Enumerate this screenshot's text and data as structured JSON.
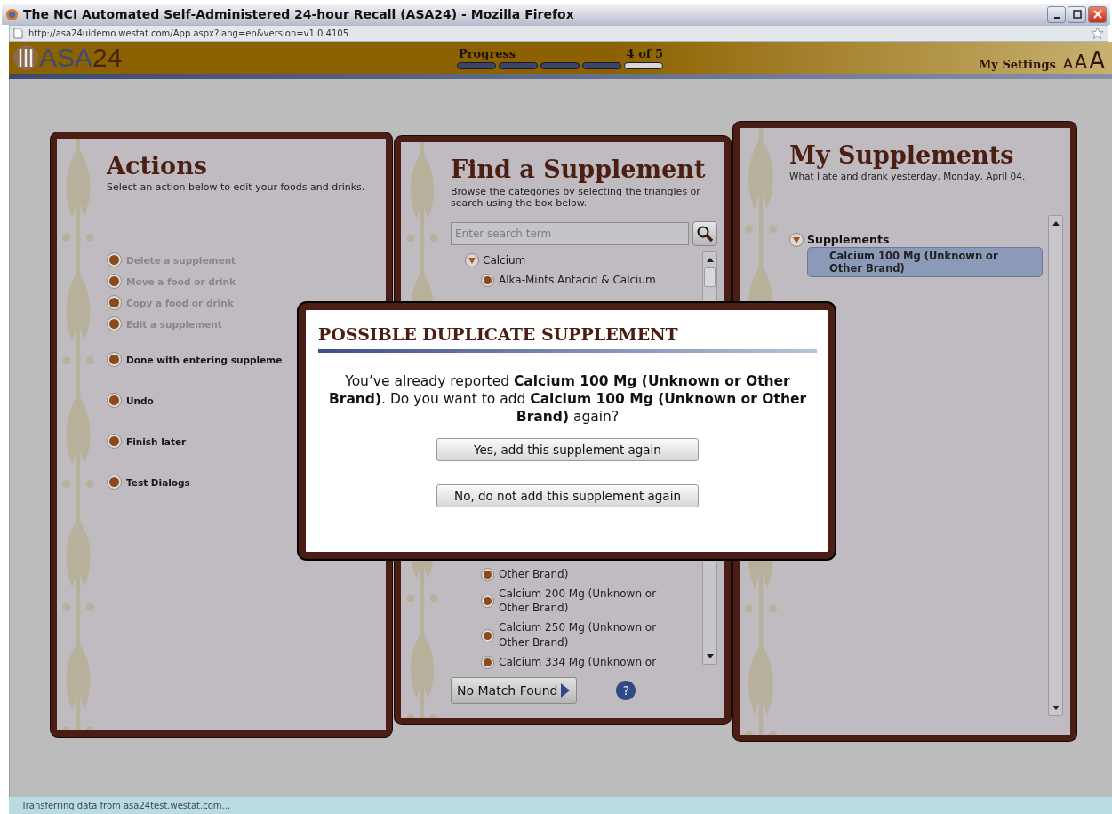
{
  "window": {
    "title": "The NCI Automated Self-Administered 24-hour Recall (ASA24) - Mozilla Firefox"
  },
  "address_bar": {
    "url": "http://asa24uidemo.westat.com/App.aspx?lang=en&version=v1.0.4105"
  },
  "header": {
    "logo_letters": "ASA",
    "logo_digits": "24",
    "progress": {
      "label": "Progress",
      "reading": "4 of 5",
      "steps": [
        {
          "done": true
        },
        {
          "done": true
        },
        {
          "done": true
        },
        {
          "done": true
        },
        {
          "done": false
        }
      ]
    },
    "settings": "My Settings",
    "text_sizes": [
      "A",
      "A",
      "A"
    ]
  },
  "actions_panel": {
    "title": "Actions",
    "subtitle": "Select an action below to edit your foods and drinks.",
    "items": [
      {
        "label": "Delete a supplement",
        "disabled": true
      },
      {
        "label": "Move a food or drink",
        "disabled": true
      },
      {
        "label": "Copy a food or drink",
        "disabled": true
      },
      {
        "label": "Edit a supplement",
        "disabled": true
      },
      {
        "label": "Done with entering suppleme",
        "disabled": false
      },
      {
        "label": "Undo",
        "disabled": false
      },
      {
        "label": "Finish later",
        "disabled": false
      },
      {
        "label": "Test Dialogs",
        "disabled": false
      }
    ]
  },
  "find_panel": {
    "title": "Find a Supplement",
    "description": "Browse the categories by selecting the triangles or search using the box below.",
    "search": {
      "placeholder": "Enter search term"
    },
    "tree": [
      {
        "label": "Calcium",
        "expanded": true,
        "children": [
          {
            "label": "Alka-Mints Antacid & Calcium",
            "kind": "top",
            "selected": false
          },
          {
            "label": "Other Brand)",
            "kind": "cut",
            "selected": false
          },
          {
            "label": "Calcium 200 Mg (Unknown or Other Brand)",
            "kind": "full",
            "selected": false
          },
          {
            "label": "Calcium 250 Mg (Unknown or Other Brand)",
            "kind": "full",
            "selected": false
          },
          {
            "label": "Calcium 334 Mg (Unknown or",
            "kind": "bottom",
            "selected": false
          }
        ]
      }
    ],
    "no_match_button": "No Match Found",
    "help": "?"
  },
  "my_panel": {
    "title": "My Supplements",
    "subtitle": "What I ate and drank yesterday, Monday, April 04.",
    "tree": [
      {
        "label": "Supplements",
        "expanded": true,
        "children": [
          {
            "label": "Calcium 100 Mg (Unknown or Other Brand)",
            "selected": true
          }
        ]
      }
    ]
  },
  "dialog": {
    "title": "POSSIBLE DUPLICATE SUPPLEMENT",
    "message": "You’ve already reported **Calcium 100 Mg (Unknown or Other Brand)**. Do you want to add **Calcium 100 Mg (Unknown or Other Brand)** again?",
    "buttons": [
      "Yes, add this supplement again",
      "No, do not add this supplement again"
    ]
  },
  "status_bar": "Transferring data from asa24test.westat.com..."
}
